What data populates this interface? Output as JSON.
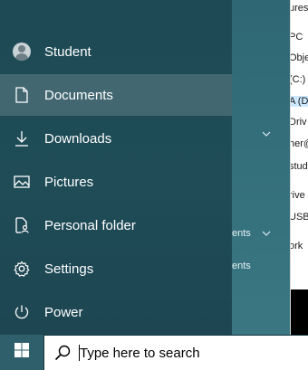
{
  "background_explorer": {
    "rows": [
      "ures",
      "PC",
      "Obje",
      "(C:)",
      "A (D",
      "Driv",
      "her@",
      "stud",
      "rive",
      "USB",
      "ork"
    ],
    "selected_row_index": 4
  },
  "background_pane": {
    "ghost_labels": [
      "ents",
      "ents"
    ]
  },
  "start_menu": {
    "items": [
      {
        "label": "Student",
        "icon": "user-avatar-icon"
      },
      {
        "label": "Documents",
        "icon": "document-icon",
        "active": true
      },
      {
        "label": "Downloads",
        "icon": "download-icon"
      },
      {
        "label": "Pictures",
        "icon": "pictures-icon"
      },
      {
        "label": "Personal folder",
        "icon": "personal-folder-icon"
      },
      {
        "label": "Settings",
        "icon": "gear-icon"
      },
      {
        "label": "Power",
        "icon": "power-icon"
      }
    ]
  },
  "taskbar": {
    "search_placeholder": "Type here to search"
  },
  "colors": {
    "panel": "#1f4c57",
    "active_item": "#4a7380",
    "taskbar": "#14363f",
    "start_button": "#2f5f6b",
    "explorer_selection": "#cce8ff"
  }
}
